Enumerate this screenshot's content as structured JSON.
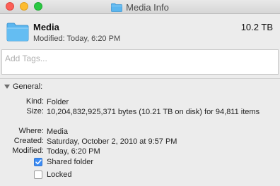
{
  "window": {
    "title": "Media Info"
  },
  "header": {
    "name": "Media",
    "modified": "Modified: Today, 6:20 PM",
    "size": "10.2 TB",
    "icon": "folder-icon"
  },
  "tags": {
    "placeholder": "Add Tags...",
    "value": ""
  },
  "general": {
    "title": "General:",
    "rows": [
      {
        "label": "Kind:",
        "value": "Folder"
      },
      {
        "label": "Size:",
        "value": "10,204,832,925,371 bytes (10.21 TB on disk) for 94,811 items"
      },
      {
        "label": "Where:",
        "value": "Media"
      },
      {
        "label": "Created:",
        "value": "Saturday, October 2, 2010 at 9:57 PM"
      },
      {
        "label": "Modified:",
        "value": "Today, 6:20 PM"
      }
    ],
    "shared": {
      "label": "Shared folder",
      "checked": true
    },
    "locked": {
      "label": "Locked",
      "checked": false
    }
  },
  "colors": {
    "folder": "#5bb6ef",
    "accent": "#3c8cf5",
    "close": "#fc5f57",
    "minimize": "#fdbc2e",
    "zoom": "#29c841"
  }
}
